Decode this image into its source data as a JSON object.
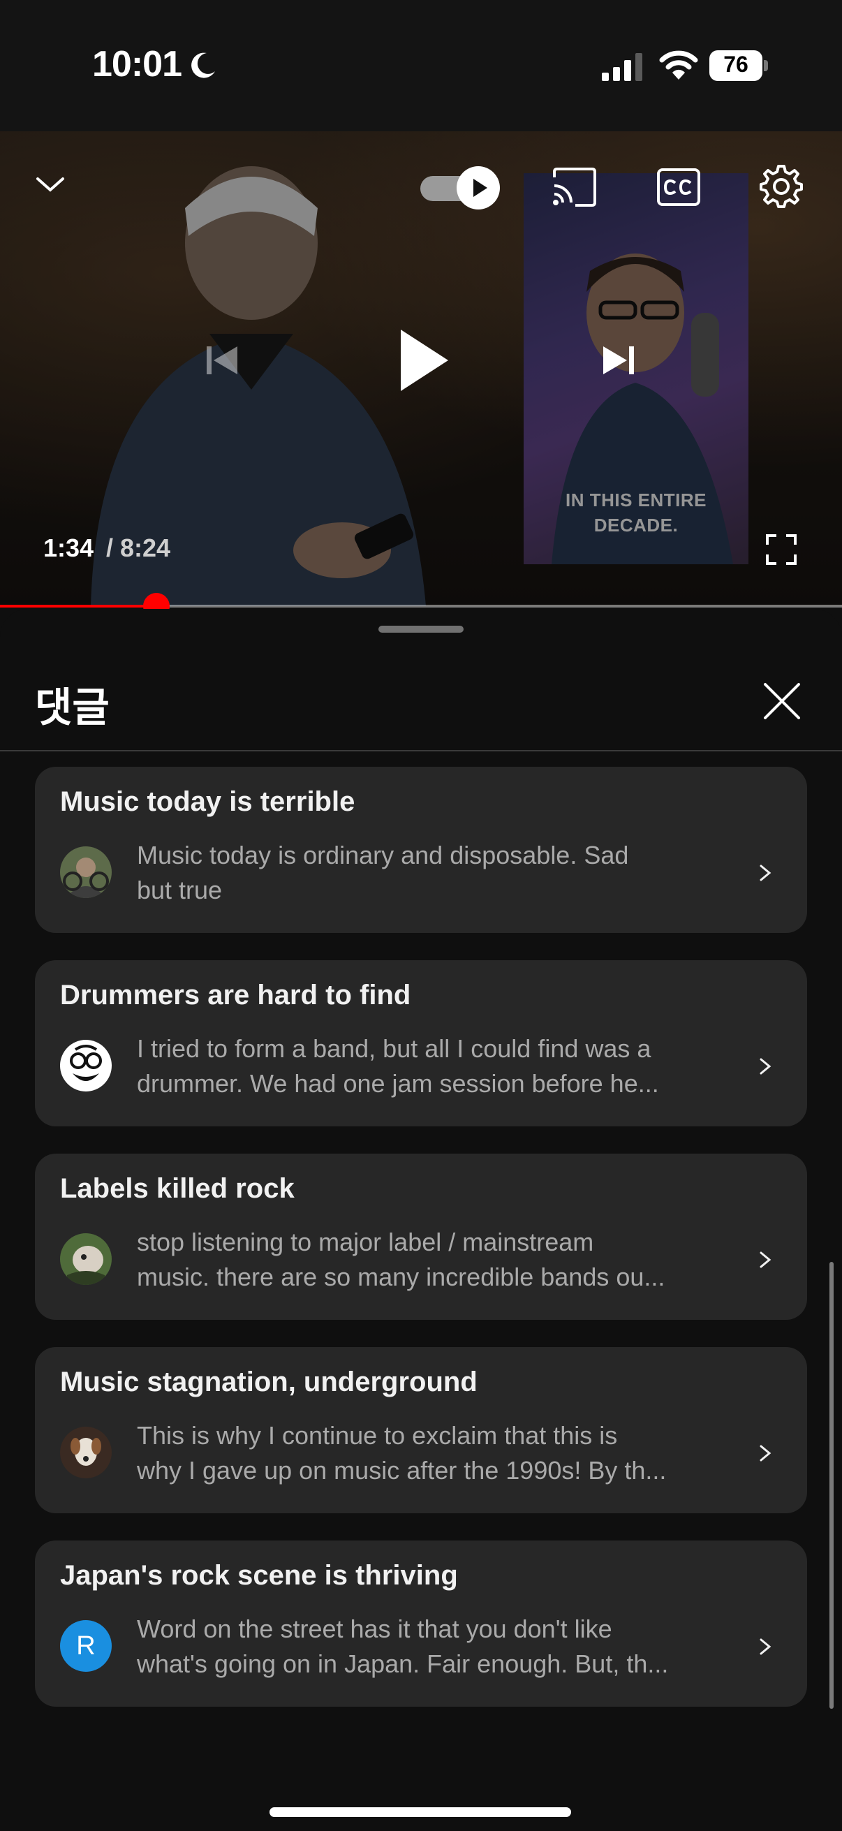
{
  "status_bar": {
    "time": "10:01",
    "battery": "76",
    "icons": [
      "moon-icon",
      "signal-icon",
      "wifi-icon",
      "battery-icon"
    ]
  },
  "player": {
    "current_time": "1:34",
    "total_time": "/ 8:24",
    "progress_fraction": 0.186,
    "autoplay_on": true,
    "inset_caption_line1": "IN THIS ENTIRE",
    "inset_caption_line2": "DECADE.",
    "icons": [
      "chevron-down-icon",
      "autoplay-toggle",
      "cast-icon",
      "cc-icon",
      "settings-icon",
      "previous-icon",
      "play-icon",
      "next-icon",
      "fullscreen-icon"
    ]
  },
  "comments_sheet": {
    "title": "댓글",
    "cards": [
      {
        "title": "Music today is terrible",
        "line1": "Music today is ordinary and disposable. Sad",
        "line2": "but true",
        "avatar": "photo"
      },
      {
        "title": "Drummers are hard to find",
        "line1": "I tried to form a band, but all I could find was a",
        "line2": "drummer. We had one jam session before he...",
        "avatar": "cartoon-face"
      },
      {
        "title": "Labels killed rock",
        "line1": "stop listening to major label / mainstream",
        "line2": "music. there are so many incredible bands ou...",
        "avatar": "photo"
      },
      {
        "title": "Music stagnation, underground",
        "line1": "This is why I continue to exclaim that this is",
        "line2": "why I gave up on music after the 1990s! By th...",
        "avatar": "dog-photo"
      },
      {
        "title": "Japan's rock scene is thriving",
        "line1": "Word on the street has it that you don't like",
        "line2": "what's going on in Japan. Fair enough. But, th...",
        "avatar_letter": "R",
        "avatar_color": "#1a8fe0"
      }
    ]
  },
  "colors": {
    "accent": "#ff0000",
    "card_bg": "#272727",
    "sheet_bg": "#0f0f0f"
  }
}
